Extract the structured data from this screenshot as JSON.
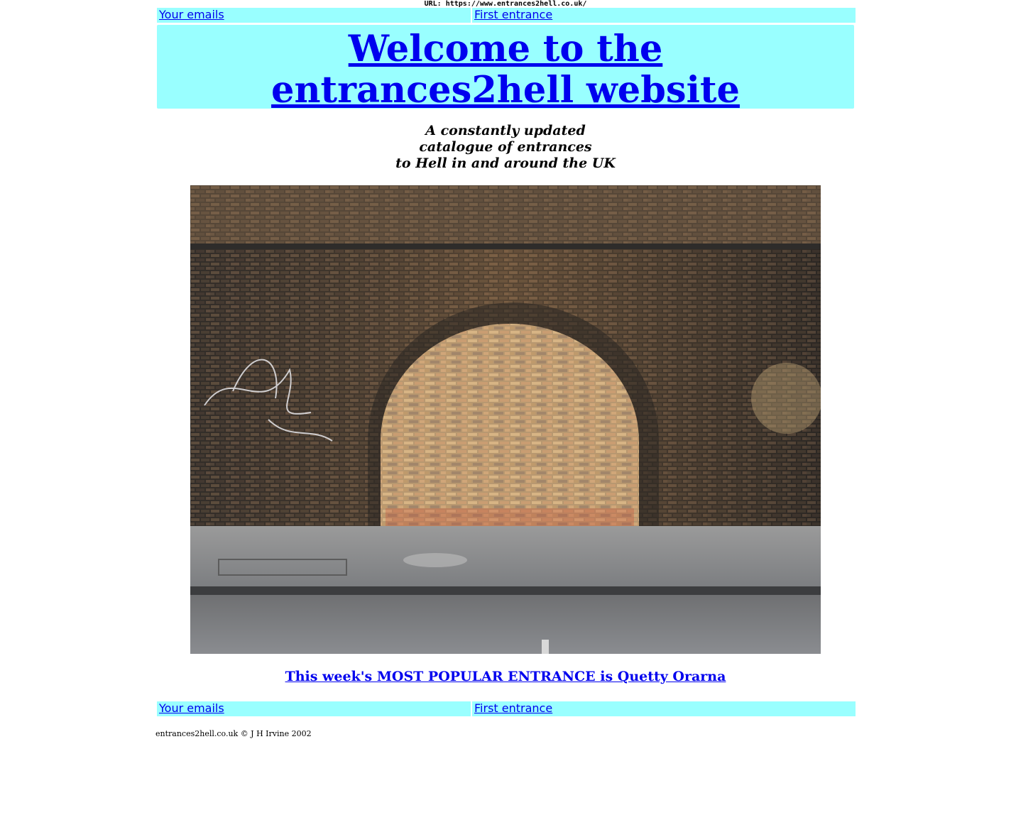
{
  "url_bar": {
    "text": "URL: https://www.entrances2hell.co.uk/"
  },
  "nav_top": {
    "left_link": "Your emails",
    "right_link": "First entrance"
  },
  "header": {
    "line1": "Welcome to the",
    "line2": "entrances2hell website"
  },
  "tagline": {
    "line1": "A constantly updated",
    "line2": "catalogue of entrances",
    "line3": "to Hell in and around the UK"
  },
  "photo": {
    "subject": "bricked-up archway in a brick wall under a railway bridge"
  },
  "popular": {
    "link": "This week's MOST POPULAR ENTRANCE is Quetty Orarna"
  },
  "nav_bottom": {
    "left_link": "Your emails",
    "right_link": "First entrance"
  },
  "footer": {
    "copyright": "entrances2hell.co.uk © J H Irvine 2002"
  },
  "colors": {
    "nav_bg": "#99ffff",
    "link": "#0000ee"
  }
}
